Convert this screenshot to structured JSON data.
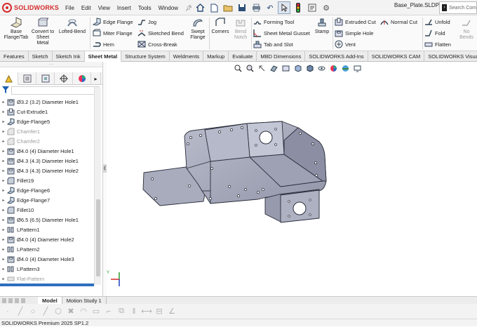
{
  "app": {
    "logo_text": "SOLIDWORKS",
    "file_name": "Base_Plate.SLDP..."
  },
  "menu": [
    "File",
    "Edit",
    "View",
    "Insert",
    "Tools",
    "Window"
  ],
  "search": {
    "placeholder": "Search Com"
  },
  "ribbon": {
    "base_flange": "Base Flange/Tab",
    "convert": "Convert to Sheet Metal",
    "lofted_bend": "Lofted-Bend",
    "edge_flange": "Edge Flange",
    "miter_flange": "Miter Flange",
    "hem": "Hem",
    "jog": "Jog",
    "sketched_bend": "Sketched Bend",
    "cross_break": "Cross-Break",
    "swept_flange": "Swept Flange",
    "corners": "Corners",
    "bend_notch": "Bend Notch",
    "forming_tool": "Forming Tool",
    "gusset": "Sheet Metal Gusset",
    "tab_slot": "Tab and Slot",
    "stamp": "Stamp",
    "extruded_cut": "Extruded Cut",
    "simple_hole": "Simple Hole",
    "vent": "Vent",
    "normal_cut": "Normal Cut",
    "unfold": "Unfold",
    "fold": "Fold",
    "flatten": "Flatten",
    "no_bends": "No Bends"
  },
  "tabs": [
    "Features",
    "Sketch",
    "Sketch Ink",
    "Sheet Metal",
    "Structure System",
    "Weldments",
    "Markup",
    "Evaluate",
    "MBD Dimensions",
    "SOLIDWORKS Add-Ins",
    "SOLIDWORKS CAM",
    "SOLIDWORKS Visualize"
  ],
  "active_tab": "Sheet Metal",
  "tree": [
    {
      "label": "Ø3.2 (3.2) Diameter Hole1",
      "icon": "hole-icon",
      "suppressed": false
    },
    {
      "label": "Cut-Extrude1",
      "icon": "cut-extrude-icon",
      "suppressed": false
    },
    {
      "label": "Edge-Flange5",
      "icon": "edge-flange-icon",
      "suppressed": false
    },
    {
      "label": "Chamfer1",
      "icon": "chamfer-icon",
      "suppressed": true
    },
    {
      "label": "Chamfer2",
      "icon": "chamfer-icon",
      "suppressed": true
    },
    {
      "label": "Ø4.0 (4) Diameter Hole1",
      "icon": "hole-icon",
      "suppressed": false
    },
    {
      "label": "Ø4.3 (4.3) Diameter Hole1",
      "icon": "hole-icon",
      "suppressed": false
    },
    {
      "label": "Ø4.3 (4.3) Diameter Hole2",
      "icon": "hole-icon",
      "suppressed": false
    },
    {
      "label": "Fillet19",
      "icon": "fillet-icon",
      "suppressed": false
    },
    {
      "label": "Edge-Flange6",
      "icon": "edge-flange-icon",
      "suppressed": false
    },
    {
      "label": "Edge-Flange7",
      "icon": "edge-flange-icon",
      "suppressed": false
    },
    {
      "label": "Fillet10",
      "icon": "fillet-icon",
      "suppressed": false
    },
    {
      "label": "Ø6.5 (6.5) Diameter Hole1",
      "icon": "hole-icon",
      "suppressed": false
    },
    {
      "label": "LPattern1",
      "icon": "linear-pattern-icon",
      "suppressed": false
    },
    {
      "label": "Ø4.0 (4) Diameter Hole2",
      "icon": "hole-icon",
      "suppressed": false
    },
    {
      "label": "LPattern2",
      "icon": "linear-pattern-icon",
      "suppressed": false
    },
    {
      "label": "Ø4.0 (4) Diameter Hole3",
      "icon": "hole-icon",
      "suppressed": false
    },
    {
      "label": "LPattern3",
      "icon": "linear-pattern-icon",
      "suppressed": false
    },
    {
      "label": "Flat-Pattern",
      "icon": "flat-pattern-icon",
      "suppressed": true
    }
  ],
  "bottom_tabs": [
    "Model",
    "Motion Study 1"
  ],
  "status": "SOLIDWORKS Premium 2025 SP1.2",
  "colors": {
    "accent": "#2f6fbf",
    "brand_red": "#d52a2a",
    "part_fill": "#a7abbd",
    "part_edge": "#2a2d3a"
  }
}
